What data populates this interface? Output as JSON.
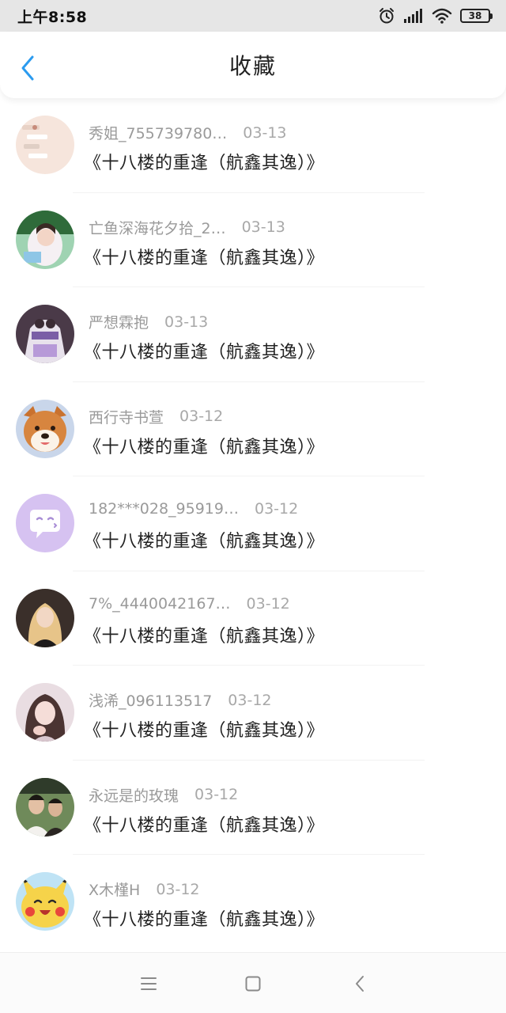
{
  "status_bar": {
    "time": "上午8:58",
    "battery": "38",
    "icons": [
      "alarm-icon",
      "signal-icon",
      "wifi-icon",
      "battery-icon"
    ]
  },
  "header": {
    "title": "收藏",
    "back_icon": "chevron-left-icon",
    "accent_color": "#2b9bef"
  },
  "favorites": [
    {
      "name": "秀姐_755739780…",
      "date": "03-13",
      "title": "《十八楼的重逢（航鑫其逸）》",
      "avatar": "chat-screenshot"
    },
    {
      "name": "亡鱼深海花夕拾_2…",
      "date": "03-13",
      "title": "《十八楼的重逢（航鑫其逸）》",
      "avatar": "girl-photo"
    },
    {
      "name": "严想霖抱",
      "date": "03-13",
      "title": "《十八楼的重逢（航鑫其逸）》",
      "avatar": "purple-character"
    },
    {
      "name": "西行寺书萱",
      "date": "03-12",
      "title": "《十八楼的重逢（航鑫其逸）》",
      "avatar": "shiba-dog"
    },
    {
      "name": "182***028_95919…",
      "date": "03-12",
      "title": "《十八楼的重逢（航鑫其逸）》",
      "avatar": "default-chat-bubble"
    },
    {
      "name": "7%_4440042167…",
      "date": "03-12",
      "title": "《十八楼的重逢（航鑫其逸）》",
      "avatar": "blonde-girl"
    },
    {
      "name": "浅浠_096113517",
      "date": "03-12",
      "title": "《十八楼的重逢（航鑫其逸）》",
      "avatar": "girl-pink"
    },
    {
      "name": "永远是的玫瑰",
      "date": "03-12",
      "title": "《十八楼的重逢（航鑫其逸）》",
      "avatar": "two-boys"
    },
    {
      "name": "X木槿H",
      "date": "03-12",
      "title": "《十八楼的重逢（航鑫其逸）》",
      "avatar": "pikachu"
    }
  ],
  "nav_bar": {
    "buttons": [
      "menu-icon",
      "home-square-icon",
      "back-triangle-icon"
    ]
  }
}
